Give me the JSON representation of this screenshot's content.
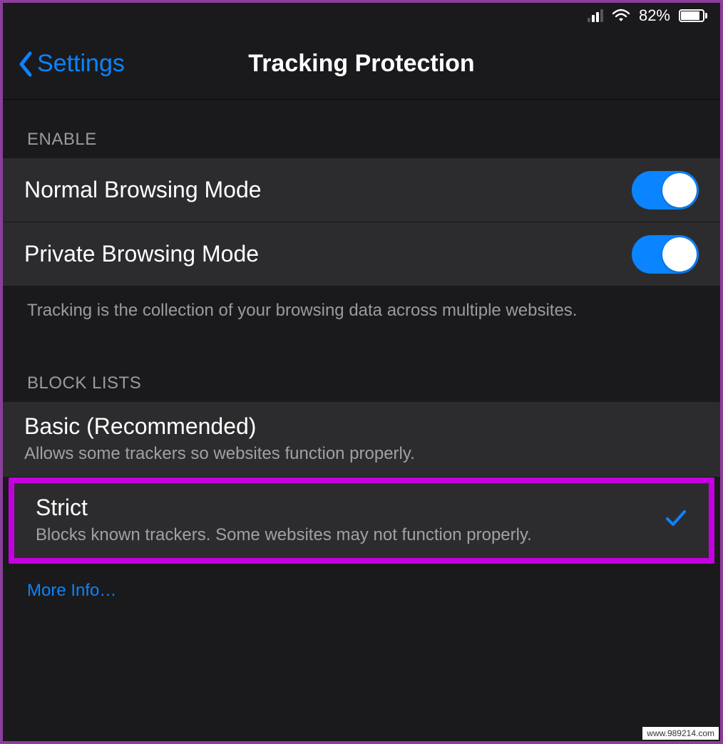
{
  "statusBar": {
    "batteryPercent": "82%",
    "batteryFill": 82
  },
  "nav": {
    "back": "Settings",
    "title": "Tracking Protection"
  },
  "sections": {
    "enable": {
      "header": "ENABLE",
      "rows": {
        "normal": {
          "label": "Normal Browsing Mode",
          "on": true
        },
        "private": {
          "label": "Private Browsing Mode",
          "on": true
        }
      },
      "footer": "Tracking is the collection of your browsing data across multiple websites."
    },
    "blockLists": {
      "header": "BLOCK LISTS",
      "basic": {
        "title": "Basic (Recommended)",
        "subtitle": "Allows some trackers so websites function properly.",
        "selected": false
      },
      "strict": {
        "title": "Strict",
        "subtitle": "Blocks known trackers. Some websites may not function properly.",
        "selected": true
      },
      "moreInfo": "More Info…"
    }
  },
  "watermark": "www.989214.com"
}
